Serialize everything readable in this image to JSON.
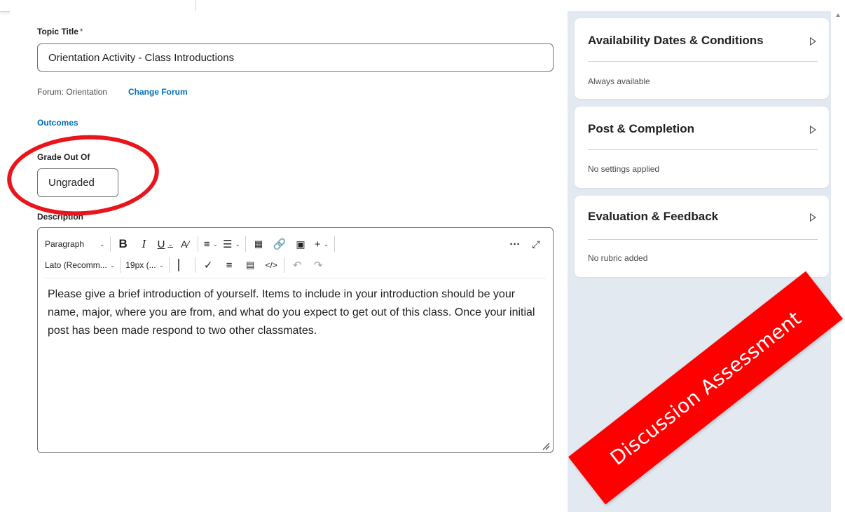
{
  "form": {
    "topic_title_label": "Topic Title",
    "required_marker": "*",
    "topic_title_value": "Orientation Activity - Class Introductions",
    "forum_text": "Forum: Orientation",
    "change_forum_link": "Change Forum",
    "outcomes_link": "Outcomes",
    "grade_label": "Grade Out Of",
    "grade_value": "Ungraded",
    "description_label": "Description"
  },
  "editor": {
    "block_format": "Paragraph",
    "font_family": "Lato (Recomm...",
    "font_size": "19px (...",
    "more_label": "···",
    "body": "Please give a brief introduction of yourself.  Items to include in your introduction should be your name, major, where you are from, and what do you expect to get out of this class. Once your initial post has been made respond to two other classmates."
  },
  "sidebar": {
    "cards": [
      {
        "title": "Availability Dates & Conditions",
        "summary": "Always available"
      },
      {
        "title": "Post & Completion",
        "summary": "No settings applied"
      },
      {
        "title": "Evaluation & Feedback",
        "summary": "No rubric added"
      }
    ]
  },
  "annotation": {
    "banner_text": "Discussion Assessment",
    "highlight_color": "#e8161c",
    "banner_color": "#ff0000"
  },
  "colors": {
    "link": "#006fbf",
    "sidebar_bg": "#e3e9f1"
  }
}
